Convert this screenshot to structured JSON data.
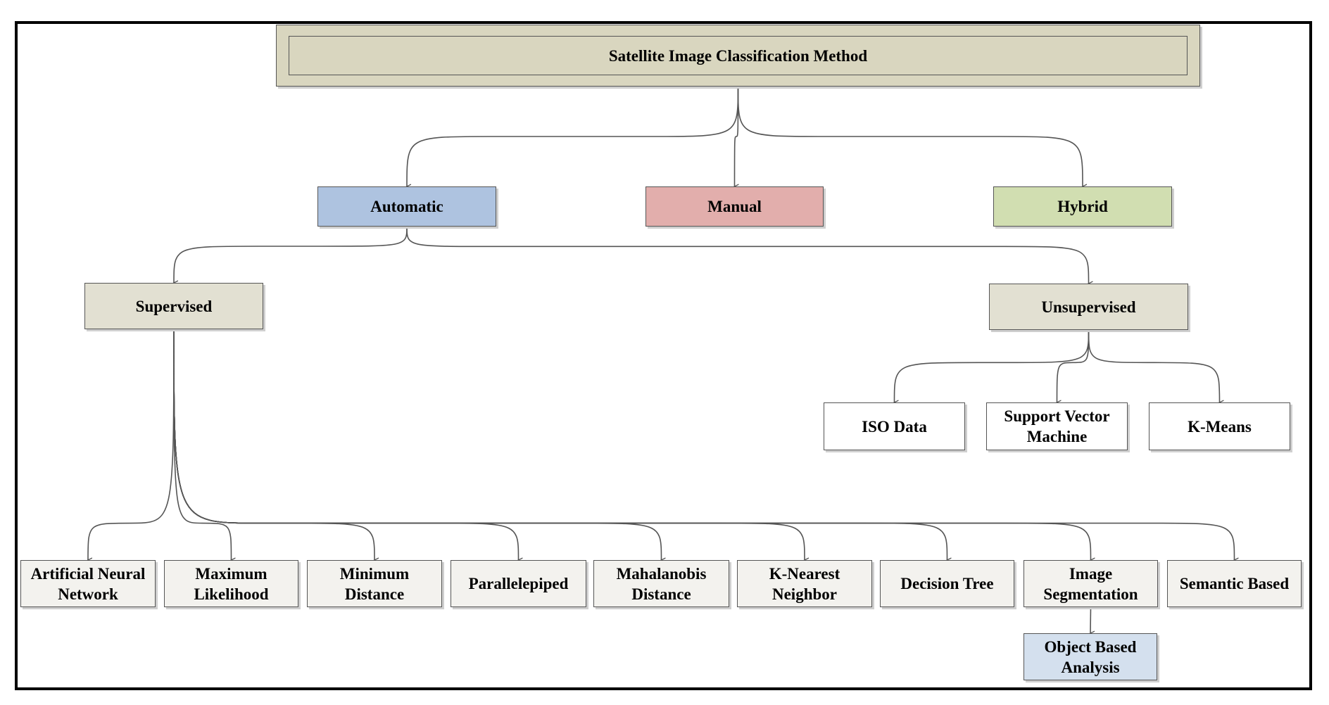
{
  "diagram": {
    "title": "Satellite Image Classification Method",
    "colors": {
      "root": "#d9d6bf",
      "automatic": "#aec3e0",
      "manual": "#e2aeac",
      "hybrid": "#d1deb1",
      "supervised": "#e2e0d2",
      "unsupervised": "#e2e0d2",
      "leaf": "#f3f2ee",
      "unsupervised_leaf": "#ffffff",
      "object_based": "#d4e0ee",
      "connector": "#555555",
      "frame": "#000000"
    },
    "level1": {
      "automatic": "Automatic",
      "manual": "Manual",
      "hybrid": "Hybrid"
    },
    "level2": {
      "supervised": "Supervised",
      "unsupervised": "Unsupervised"
    },
    "unsupervised_methods": [
      "ISO Data",
      [
        "Support Vector",
        "Machine"
      ],
      "K-Means"
    ],
    "supervised_methods": [
      [
        "Artificial Neural",
        "Network"
      ],
      [
        "Maximum",
        "Likelihood"
      ],
      [
        "Minimum",
        "Distance"
      ],
      "Parallelepiped",
      [
        "Mahalanobis",
        "Distance"
      ],
      [
        "K-Nearest",
        "Neighbor"
      ],
      "Decision Tree",
      [
        "Image",
        "Segmentation"
      ],
      "Semantic Based"
    ],
    "image_segmentation_child": [
      "Object Based",
      "Analysis"
    ],
    "edges": [
      [
        "root",
        "automatic"
      ],
      [
        "root",
        "manual"
      ],
      [
        "root",
        "hybrid"
      ],
      [
        "automatic",
        "supervised"
      ],
      [
        "automatic",
        "unsupervised"
      ],
      [
        "unsupervised",
        "iso-data"
      ],
      [
        "unsupervised",
        "svm"
      ],
      [
        "unsupervised",
        "k-means"
      ],
      [
        "supervised",
        "ann"
      ],
      [
        "supervised",
        "max-likelihood"
      ],
      [
        "supervised",
        "min-distance"
      ],
      [
        "supervised",
        "parallelepiped"
      ],
      [
        "supervised",
        "mahalanobis"
      ],
      [
        "supervised",
        "knn"
      ],
      [
        "supervised",
        "decision-tree"
      ],
      [
        "supervised",
        "image-segmentation"
      ],
      [
        "supervised",
        "semantic-based"
      ],
      [
        "image-segmentation",
        "object-based"
      ]
    ]
  }
}
